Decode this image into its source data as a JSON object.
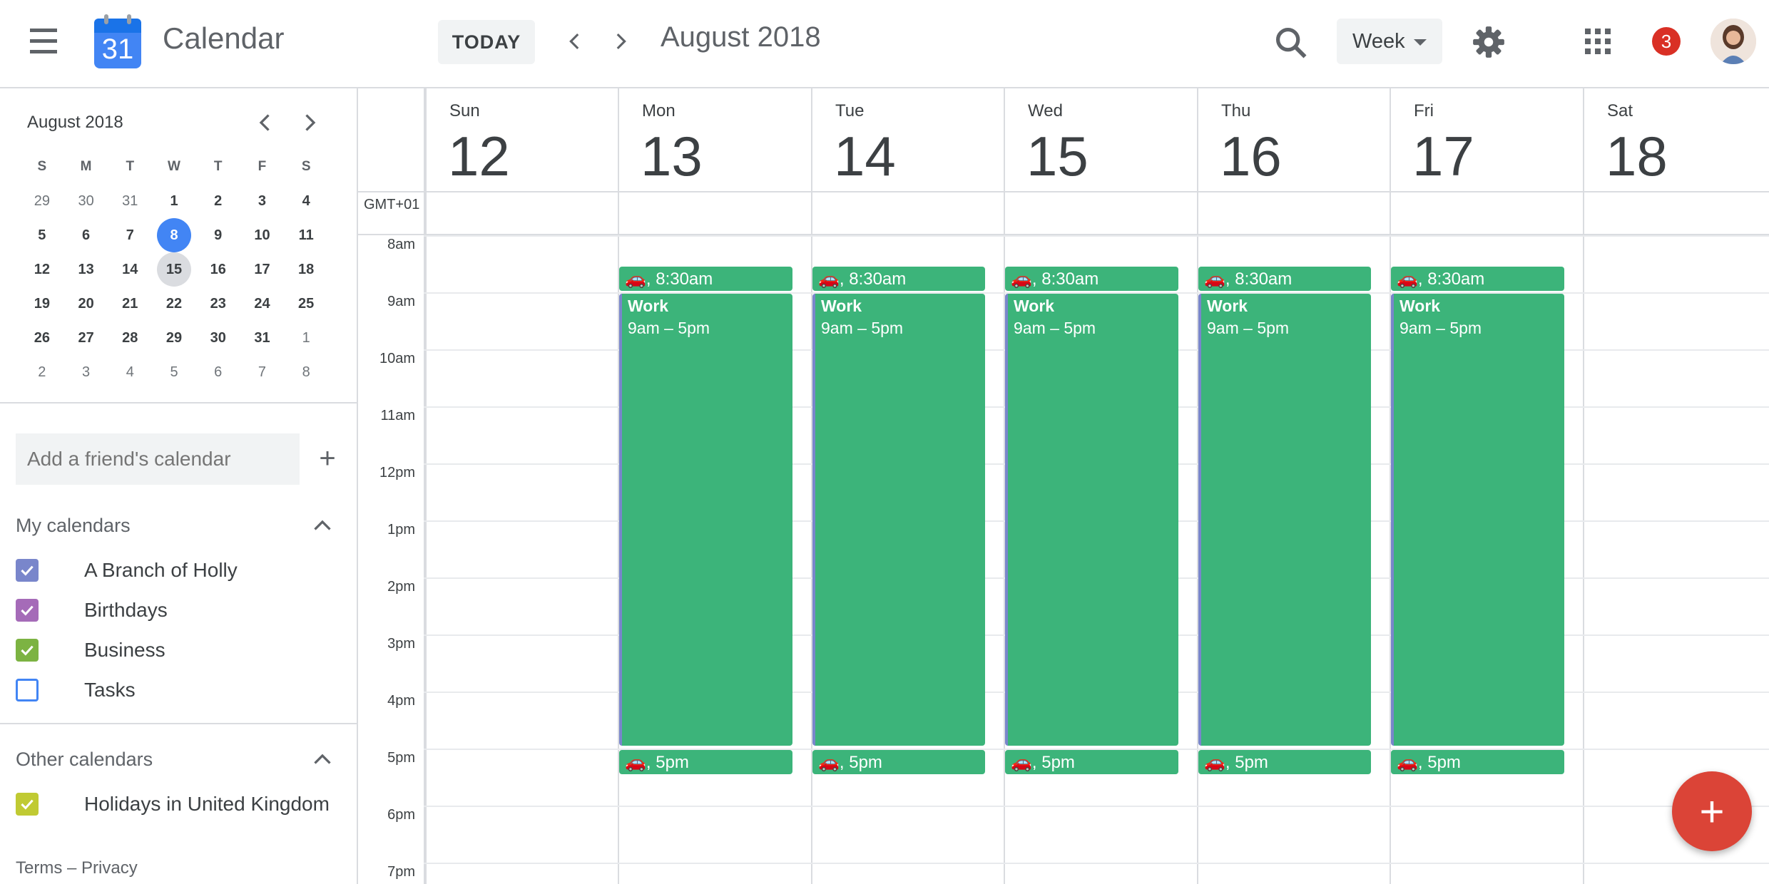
{
  "header": {
    "logo_day": "31",
    "title": "Calendar",
    "today_label": "TODAY",
    "period": "August 2018",
    "view_label": "Week",
    "notification_count": "3",
    "icons": [
      "menu-icon",
      "search-icon",
      "gear-icon",
      "apps-icon",
      "chevron-left-icon",
      "chevron-right-icon"
    ]
  },
  "mini_calendar": {
    "title": "August 2018",
    "weekdays": [
      "S",
      "M",
      "T",
      "W",
      "T",
      "F",
      "S"
    ],
    "weeks": [
      [
        "29",
        "30",
        "31",
        "1",
        "2",
        "3",
        "4"
      ],
      [
        "5",
        "6",
        "7",
        "8",
        "9",
        "10",
        "11"
      ],
      [
        "12",
        "13",
        "14",
        "15",
        "16",
        "17",
        "18"
      ],
      [
        "19",
        "20",
        "21",
        "22",
        "23",
        "24",
        "25"
      ],
      [
        "26",
        "27",
        "28",
        "29",
        "30",
        "31",
        "1"
      ],
      [
        "2",
        "3",
        "4",
        "5",
        "6",
        "7",
        "8"
      ]
    ],
    "selected_day": "8",
    "current_week_day": "15"
  },
  "friend_calendar": {
    "placeholder": "Add a friend's calendar"
  },
  "my_calendars": {
    "title": "My calendars",
    "items": [
      {
        "label": "A Branch of Holly",
        "checked": true,
        "color": "#7986cb"
      },
      {
        "label": "Birthdays",
        "checked": true,
        "color": "#a56bb8"
      },
      {
        "label": "Business",
        "checked": true,
        "color": "#7cb342"
      },
      {
        "label": "Tasks",
        "checked": false,
        "color": "#4285f4"
      }
    ]
  },
  "other_calendars": {
    "title": "Other calendars",
    "items": [
      {
        "label": "Holidays in United Kingdom",
        "checked": true,
        "color": "#c0ca33"
      }
    ]
  },
  "footer": {
    "terms": "Terms – Privacy"
  },
  "week": {
    "timezone": "GMT+01",
    "days": [
      {
        "name": "Sun",
        "num": "12"
      },
      {
        "name": "Mon",
        "num": "13"
      },
      {
        "name": "Tue",
        "num": "14"
      },
      {
        "name": "Wed",
        "num": "15"
      },
      {
        "name": "Thu",
        "num": "16"
      },
      {
        "name": "Fri",
        "num": "17"
      },
      {
        "name": "Sat",
        "num": "18"
      }
    ],
    "hours": [
      "8am",
      "9am",
      "10am",
      "11am",
      "12pm",
      "1pm",
      "2pm",
      "3pm",
      "4pm",
      "5pm",
      "6pm",
      "7pm"
    ],
    "events": {
      "commute_morning": "🚗, 8:30am",
      "work_title": "Work",
      "work_range": "9am – 5pm",
      "commute_evening": "🚗, 5pm",
      "work_days": [
        "Mon",
        "Tue",
        "Wed",
        "Thu",
        "Fri"
      ],
      "event_color": "#3cb47a"
    }
  },
  "fab": {
    "label": "+"
  }
}
